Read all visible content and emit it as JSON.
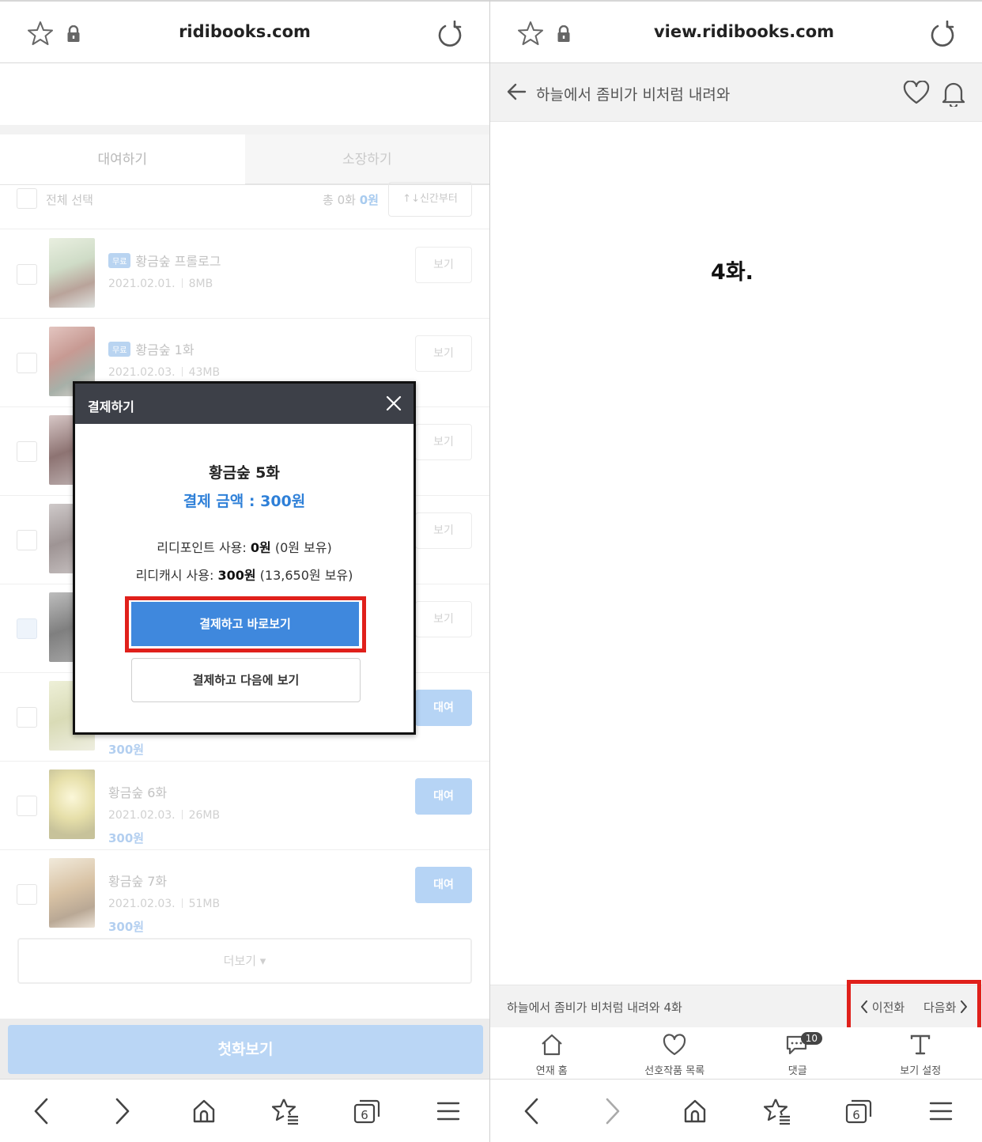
{
  "left": {
    "url": "ridibooks.com",
    "tabs": {
      "rent": "대여하기",
      "own": "소장하기"
    },
    "select_all": "전체 선택",
    "total_label": "총 0화",
    "total_price": "0원",
    "sort_label": "↑↓신간부터",
    "episodes": [
      {
        "badge": "무료",
        "title": "황금숲 프롤로그",
        "date": "2021.02.01.",
        "size": "8MB",
        "button": "보기"
      },
      {
        "badge": "무료",
        "title": "황금숲 1화",
        "date": "2021.02.03.",
        "size": "43MB",
        "button": "보기"
      },
      {
        "button": "보기"
      },
      {
        "button": "보기"
      },
      {
        "button": "보기"
      },
      {
        "price": "300원",
        "button": "대여"
      },
      {
        "title": "황금숲 6화",
        "date": "2021.02.03.",
        "size": "26MB",
        "price": "300원",
        "button": "대여"
      },
      {
        "title": "황금숲 7화",
        "date": "2021.02.03.",
        "size": "51MB",
        "price": "300원",
        "button": "대여"
      }
    ],
    "more": "더보기 ▾",
    "first_view": "첫화보기",
    "modal": {
      "header": "결제하기",
      "title": "황금숲 5화",
      "amount": "결제 금액 : 300원",
      "point_label": "리디포인트 사용: ",
      "point_value": "0원",
      "point_hold": " (0원 보유)",
      "cash_label": "리디캐시 사용: ",
      "cash_value": "300원",
      "cash_hold": " (13,650원 보유)",
      "pay_view": "결제하고 바로보기",
      "pay_later": "결제하고 다음에 보기"
    },
    "toolbar_tab_count": "6"
  },
  "right": {
    "url": "view.ridibooks.com",
    "header_title": "하늘에서 좀비가 비처럼 내려와",
    "chapter": "4화.",
    "nav_title": "하늘에서 좀비가 비처럼 내려와 4화",
    "prev": "이전화",
    "next": "다음화",
    "tabs": [
      {
        "label": "연재 홈",
        "icon": "home-icon"
      },
      {
        "label": "선호작품 목록",
        "icon": "heart-icon"
      },
      {
        "label": "댓글",
        "icon": "comment-icon",
        "badge": "10"
      },
      {
        "label": "보기 설정",
        "icon": "text-settings-icon"
      }
    ],
    "toolbar_tab_count": "6"
  },
  "colors": {
    "accent_blue": "#3f88dd",
    "highlight_red": "#e0201b",
    "modal_header": "#3d4048"
  }
}
